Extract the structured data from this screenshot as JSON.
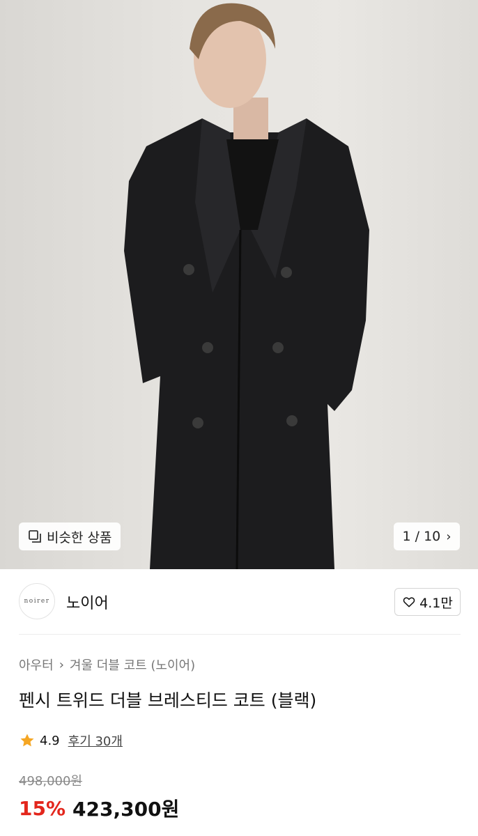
{
  "hero": {
    "similar_label": "비슷한 상품",
    "pager": "1 / 10"
  },
  "brand": {
    "logo_text": "noirer",
    "name": "노이어",
    "likes": "4.1만"
  },
  "breadcrumb": {
    "level1": "아우터",
    "level2": "겨울 더블 코트 (노이어)"
  },
  "product": {
    "title": "펜시 트위드 더블 브레스티드 코트 (블랙)",
    "rating": "4.9",
    "reviews": "후기 30개",
    "original_price": "498,000원",
    "discount": "15%",
    "sale_price": "423,300원"
  },
  "colors": {
    "accent_red": "#e3261c",
    "star": "#f5a623"
  }
}
